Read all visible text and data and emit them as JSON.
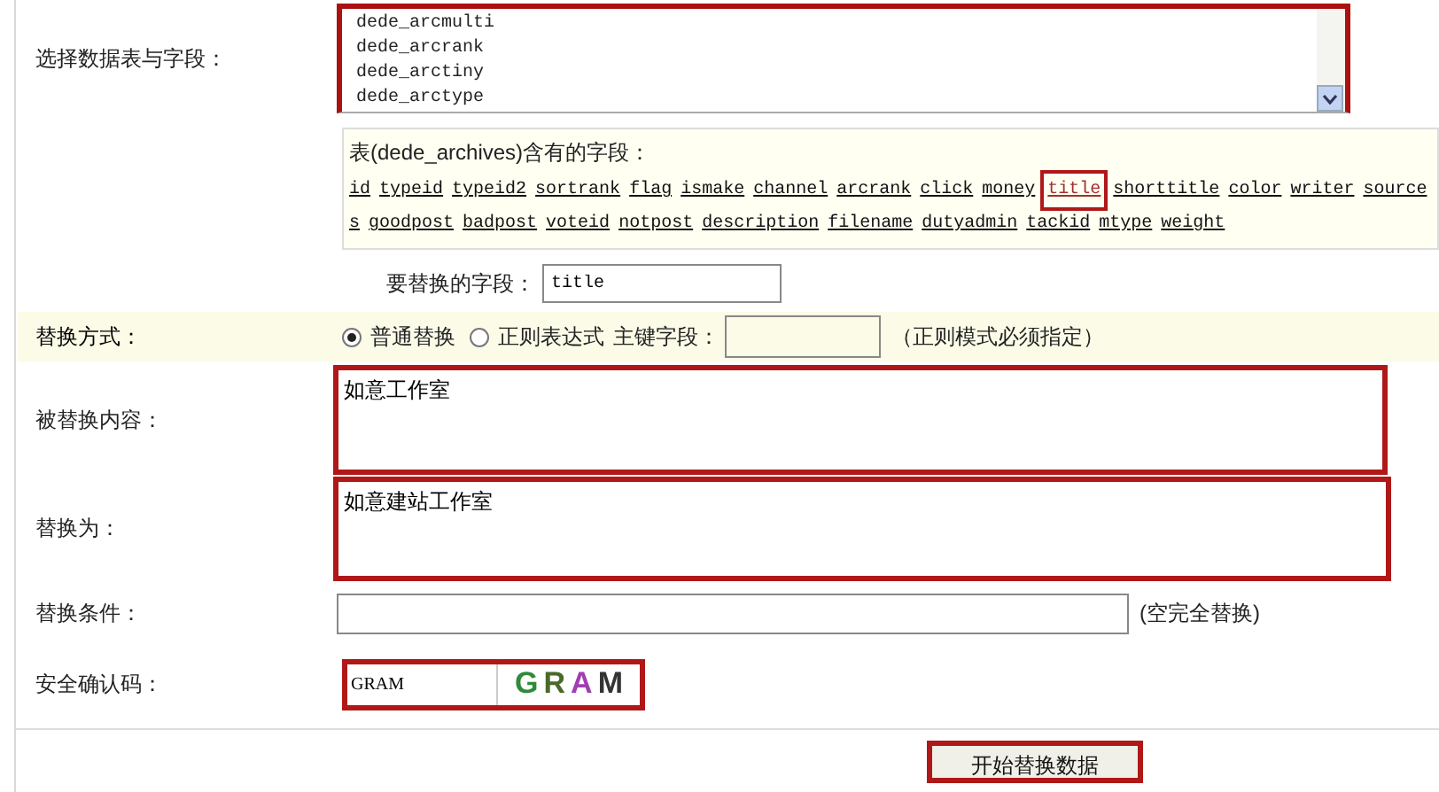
{
  "table_select": {
    "label": "选择数据表与字段：",
    "items": [
      {
        "text": "dede_arcmulti",
        "selected": false
      },
      {
        "text": "dede_arcrank",
        "selected": false
      },
      {
        "text": "dede_arctiny",
        "selected": false
      },
      {
        "text": "dede_arctype",
        "selected": false
      }
    ]
  },
  "fields_panel": {
    "heading": "表(dede_archives)含有的字段：",
    "links": [
      {
        "text": "id",
        "selected": false
      },
      {
        "text": "typeid",
        "selected": false
      },
      {
        "text": "typeid2",
        "selected": false
      },
      {
        "text": "sortrank",
        "selected": false
      },
      {
        "text": "flag",
        "selected": false
      },
      {
        "text": "ismake",
        "selected": false
      },
      {
        "text": "channel",
        "selected": false
      },
      {
        "text": "arcrank",
        "selected": false
      },
      {
        "text": "click",
        "selected": false
      },
      {
        "text": "money",
        "selected": false
      },
      {
        "text": "title",
        "selected": true
      },
      {
        "text": "shorttitle",
        "selected": false
      },
      {
        "text": "color",
        "selected": false
      },
      {
        "text": "writer",
        "selected": false
      },
      {
        "text": "source",
        "selected": false
      },
      {
        "text": "s",
        "selected": false
      },
      {
        "text": "goodpost",
        "selected": false
      },
      {
        "text": "badpost",
        "selected": false
      },
      {
        "text": "voteid",
        "selected": false
      },
      {
        "text": "notpost",
        "selected": false
      },
      {
        "text": "description",
        "selected": false
      },
      {
        "text": "filename",
        "selected": false
      },
      {
        "text": "dutyadmin",
        "selected": false
      },
      {
        "text": "tackid",
        "selected": false
      },
      {
        "text": "mtype",
        "selected": false
      },
      {
        "text": "weight",
        "selected": false
      }
    ]
  },
  "field_to_replace": {
    "label": "要替换的字段：",
    "value": "title"
  },
  "replace_mode": {
    "label": "替换方式：",
    "options": [
      {
        "text": "普通替换",
        "selected": true
      },
      {
        "text": "正则表达式",
        "selected": false
      }
    ],
    "key_label": "主键字段：",
    "note": "（正则模式必须指定）"
  },
  "find_text": {
    "label": "被替换内容：",
    "value": "如意工作室"
  },
  "replace_with": {
    "label": "替换为：",
    "value": "如意建站工作室"
  },
  "condition": {
    "label": "替换条件：",
    "note": "(空完全替换)"
  },
  "captcha": {
    "label": "安全确认码：",
    "value": "GRAM",
    "letters": [
      {
        "char": "G",
        "color": "#2f8a3a"
      },
      {
        "char": "R",
        "color": "#4a6a2a"
      },
      {
        "char": "A",
        "color": "#a040b0"
      },
      {
        "char": "M",
        "color": "#333333"
      }
    ]
  },
  "submit": "开始替换数据"
}
